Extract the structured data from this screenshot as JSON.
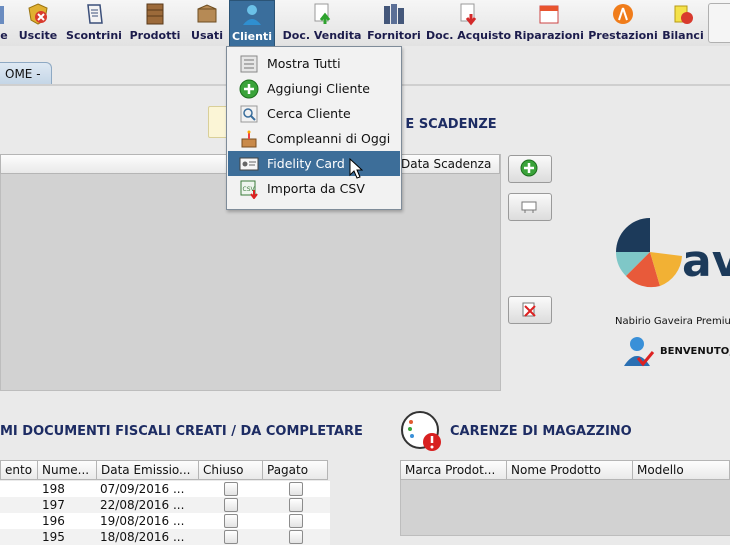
{
  "toolbar": {
    "items": [
      {
        "label": "e",
        "icon": "partial-icon"
      },
      {
        "label": "Uscite",
        "icon": "uscite-icon"
      },
      {
        "label": "Scontrini",
        "icon": "scontrini-icon"
      },
      {
        "label": "Prodotti",
        "icon": "prodotti-icon"
      },
      {
        "label": "Usati",
        "icon": "usati-icon"
      },
      {
        "label": "Clienti",
        "icon": "clienti-icon"
      },
      {
        "label": "Doc. Vendita",
        "icon": "doc-vendita-icon"
      },
      {
        "label": "Fornitori",
        "icon": "fornitori-icon"
      },
      {
        "label": "Doc. Acquisto",
        "icon": "doc-acquisto-icon"
      },
      {
        "label": "Riparazioni",
        "icon": "riparazioni-icon"
      },
      {
        "label": "Prestazioni",
        "icon": "prestazioni-icon"
      },
      {
        "label": "Bilanci",
        "icon": "bilanci-icon"
      }
    ]
  },
  "tab": {
    "label": "OME -"
  },
  "scadenze": {
    "title": "E E SCADENZE",
    "header_data_scadenza": "Data Scadenza"
  },
  "documenti": {
    "title": "MI DOCUMENTI FISCALI CREATI / DA COMPLETARE",
    "columns": [
      "ento",
      "Nume...",
      "Data Emissio...",
      "Chiuso",
      "Pagato"
    ],
    "rows": [
      {
        "num": "198",
        "data": "07/09/2016 ..."
      },
      {
        "num": "197",
        "data": "22/08/2016 ..."
      },
      {
        "num": "196",
        "data": "19/08/2016 ..."
      },
      {
        "num": "195",
        "data": "18/08/2016 ..."
      }
    ]
  },
  "carenze": {
    "title": "CARENZE DI MAGAZZINO",
    "columns": [
      "Marca Prodot...",
      "Nome Prodotto",
      "Modello"
    ]
  },
  "menu": {
    "items": [
      {
        "label": "Mostra Tutti"
      },
      {
        "label": "Aggiungi Cliente"
      },
      {
        "label": "Cerca Cliente"
      },
      {
        "label": "Compleanni di Oggi"
      },
      {
        "label": "Fidelity Card"
      },
      {
        "label": "Importa da CSV"
      }
    ]
  },
  "info": {
    "owner": "Nabirio Gaveira Premium",
    "welcome": "BENVENUTO,",
    "logo_letters": "av"
  }
}
